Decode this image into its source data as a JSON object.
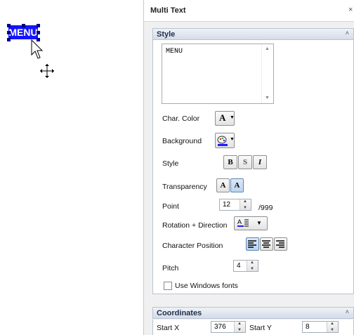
{
  "canvas": {
    "selected_text": "MENU"
  },
  "panel": {
    "title": "Multi Text",
    "close_glyph": "×"
  },
  "style_section": {
    "header": "Style",
    "collapse_glyph": "˄",
    "text_value": "MENU",
    "char_color_label": "Char. Color",
    "char_color_glyph": "A",
    "background_label": "Background",
    "style_label": "Style",
    "style_bold": "B",
    "style_shadow": "S",
    "style_italic": "I",
    "transparency_label": "Transparency",
    "transparency_a1": "A",
    "transparency_a2": "A",
    "point_label": "Point",
    "point_value": "12",
    "point_max": "/999",
    "rotation_label": "Rotation + Direction",
    "char_position_label": "Character Position",
    "pitch_label": "Pitch",
    "pitch_value": "4",
    "use_windows_fonts_label": "Use Windows fonts"
  },
  "coordinates_section": {
    "header": "Coordinates",
    "collapse_glyph": "˄",
    "start_x_label": "Start X",
    "start_x_value": "376",
    "start_y_label": "Start Y",
    "start_y_value": "8"
  },
  "icons": [
    "arrow-cursor-icon",
    "move-icon",
    "font-color-icon",
    "background-palette-icon",
    "dropdown-arrow-icon",
    "spin-up-icon",
    "spin-down-icon",
    "text-direction-icon",
    "align-left-icon",
    "align-center-icon",
    "align-right-icon"
  ],
  "colors": {
    "selection_bg": "#1414ff",
    "selection_handle": "#00008b",
    "panel_bg": "#f0f0f0",
    "header_text": "#1e2e4a",
    "char_color_underline": "#1e1eff"
  }
}
